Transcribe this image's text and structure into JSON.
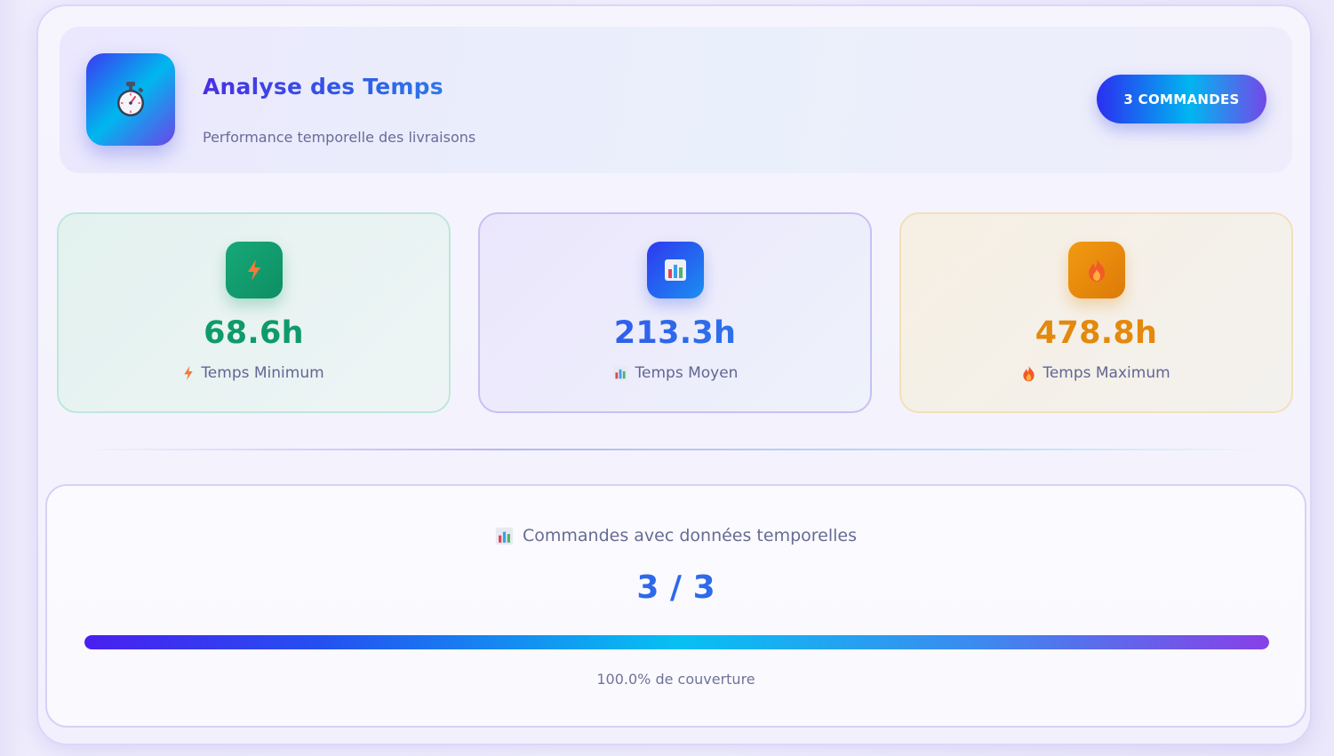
{
  "header": {
    "title": "Analyse des Temps",
    "subtitle": "Performance temporelle des livraisons",
    "icon": "stopwatch-icon",
    "badge_label": "3 COMMANDES"
  },
  "stats": {
    "min": {
      "value": "68.6h",
      "label": "Temps Minimum",
      "icon": "lightning-icon",
      "color": "#0f9a6a"
    },
    "avg": {
      "value": "213.3h",
      "label": "Temps Moyen",
      "icon": "bar-chart-icon",
      "color": "#2a5fe8"
    },
    "max": {
      "value": "478.8h",
      "label": "Temps Maximum",
      "icon": "fire-icon",
      "color": "#e3890d"
    }
  },
  "coverage": {
    "title": "Commandes avec données temporelles",
    "icon": "bar-chart-icon",
    "count": "3 / 3",
    "progress_fraction": 1.0,
    "percent_text": "100.0% de couverture"
  }
}
